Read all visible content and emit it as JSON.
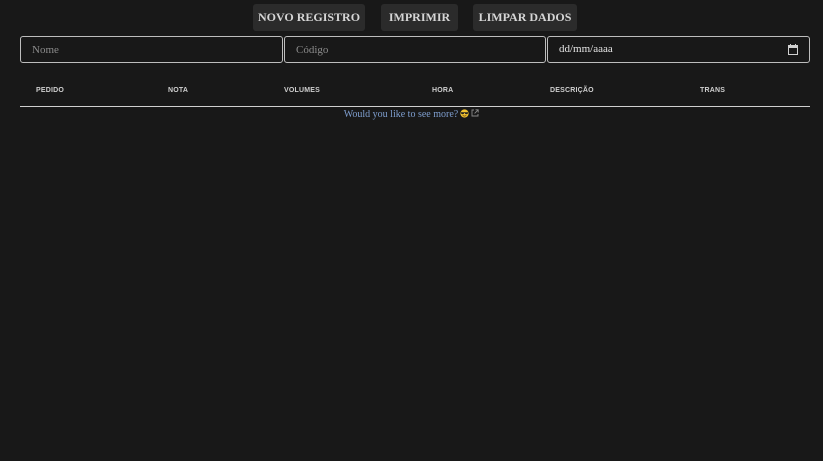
{
  "toolbar": {
    "new_record_label": "NOVO REGISTRO",
    "print_label": "IMPRIMIR",
    "clear_label": "LIMPAR DADOS"
  },
  "filters": {
    "name_placeholder": "Nome",
    "code_placeholder": "Código",
    "date_placeholder": "dd/mm/aaaa"
  },
  "table": {
    "columns": [
      "PEDIDO",
      "NOTA",
      "VOLUMES",
      "HORA",
      "DESCRIÇÃO",
      "TRANS"
    ],
    "rows": []
  },
  "footer": {
    "see_more_text": "Would you like to see more?",
    "emoji_icon": "smiling-face-with-sunglasses-icon",
    "link_icon": "external-link-icon"
  },
  "colors": {
    "background": "#181818",
    "button_bg": "#2b2b2b",
    "link": "#7f9fd0"
  }
}
